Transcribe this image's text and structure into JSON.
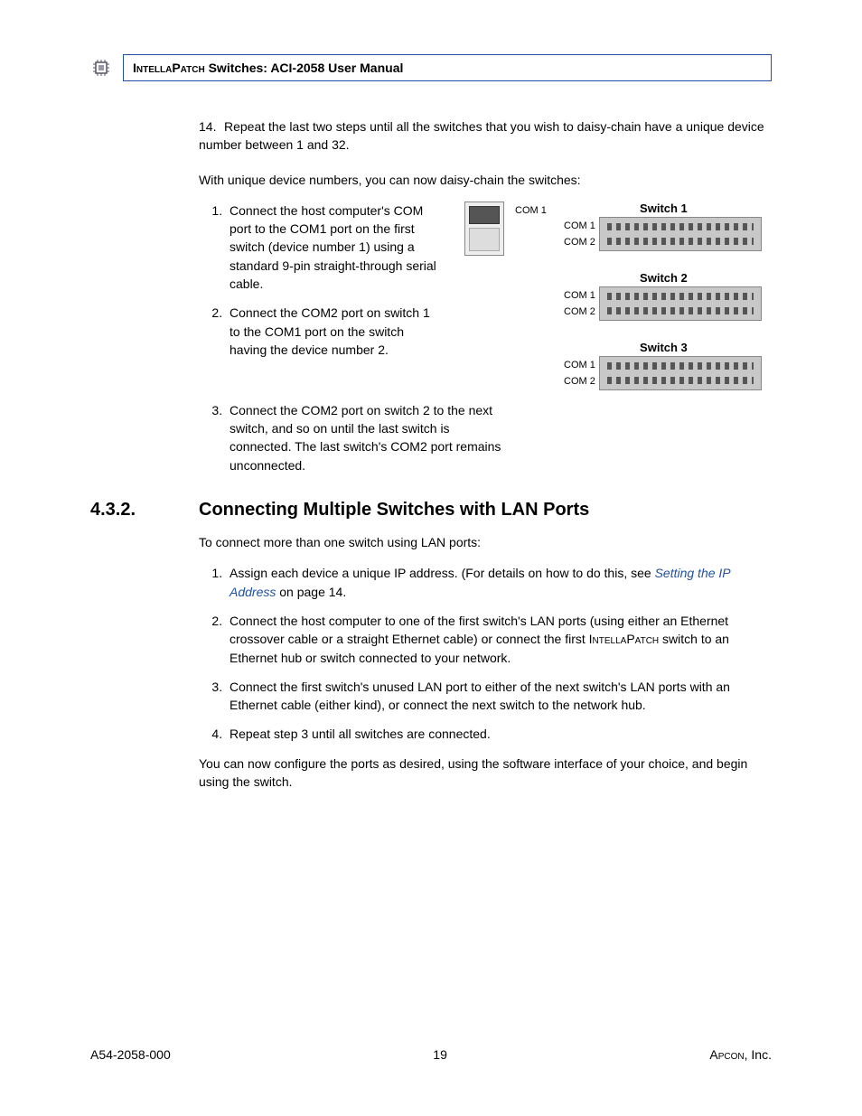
{
  "header": {
    "brand": "IntellaPatch",
    "title_rest": " Switches: ACI-2058 User Manual"
  },
  "step14": {
    "num": "14.",
    "text": "Repeat the last two steps until all the switches that you wish to daisy-chain have a unique device number between 1 and 32."
  },
  "intro_chain": "With unique device numbers, you can now daisy-chain the switches:",
  "chain_steps": {
    "s1": "Connect the host computer's COM port to the COM1 port on the first switch (device number 1) using a standard 9-pin straight-through serial cable.",
    "s2": "Connect the COM2 port on switch 1 to the COM1 port on the switch having the device number 2.",
    "s3": "Connect the COM2 port on switch 2 to the next switch, and so on until the last switch is connected. The last switch's COM2 port remains unconnected."
  },
  "diagram": {
    "switch1": "Switch 1",
    "switch2": "Switch 2",
    "switch3": "Switch 3",
    "com1": "COM 1",
    "com2": "COM 2"
  },
  "section": {
    "num": "4.3.2.",
    "title": "Connecting Multiple Switches with LAN Ports"
  },
  "lan_intro": "To connect more than one switch using LAN ports:",
  "lan_steps": {
    "s1_a": "Assign each device a unique IP address. (For details on how to do this, see ",
    "s1_link": "Setting the IP Address",
    "s1_b": " on page 14.",
    "s2_a": "Connect the host computer to one of the first switch's LAN ports (using either an Ethernet crossover cable or a straight Ethernet cable) or connect the first ",
    "s2_sc": "IntellaPatch",
    "s2_b": " switch to an Ethernet hub or switch connected to your network.",
    "s3": "Connect the first switch's unused LAN port to either of the next switch's LAN ports with an Ethernet cable (either kind), or connect the next switch to the network hub.",
    "s4": "Repeat step 3 until all switches are connected."
  },
  "closing": "You can now configure the ports as desired, using the software interface of your choice, and begin using the switch.",
  "footer": {
    "left": "A54-2058-000",
    "center": "19",
    "right_a": "Apcon",
    "right_b": ", Inc."
  }
}
